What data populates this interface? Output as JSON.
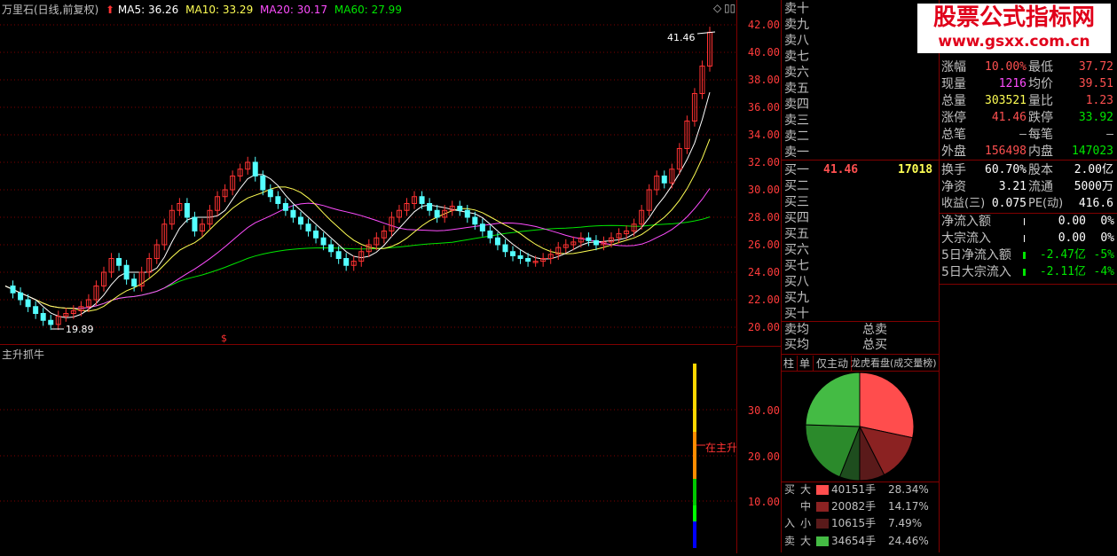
{
  "chart_title": "万里石(日线,前复权)",
  "ma_legend": [
    {
      "label": "MA5: 36.26",
      "color": "#ffffff"
    },
    {
      "label": "MA10: 33.29",
      "color": "#ffff54"
    },
    {
      "label": "MA20: 30.17",
      "color": "#ff4dff"
    },
    {
      "label": "MA60: 27.99",
      "color": "#00e600"
    }
  ],
  "price_ticks": [
    "42.00",
    "40.00",
    "38.00",
    "36.00",
    "34.00",
    "32.00",
    "30.00",
    "28.00",
    "26.00",
    "24.00",
    "22.00",
    "20.00"
  ],
  "high_label": "41.46",
  "low_label": "19.89",
  "dollar_mark": "$",
  "sub_title": "主升抓牛",
  "sub_ticks": [
    "30.00",
    "20.00",
    "10.00"
  ],
  "sub_annotation": "在主升",
  "orderbook": {
    "sell": [
      "卖十",
      "卖九",
      "卖八",
      "卖七",
      "卖六",
      "卖五",
      "卖四",
      "卖三",
      "卖二",
      "卖一"
    ],
    "buy": [
      "买一",
      "买二",
      "买三",
      "买四",
      "买五",
      "买六",
      "买七",
      "买八",
      "买九",
      "买十"
    ],
    "buy1_price": "41.46",
    "buy1_vol": "17018",
    "avg_sell": "卖均",
    "avg_buy": "买均",
    "total_sell": "总卖",
    "total_buy": "总买"
  },
  "watermark": {
    "title": "股票公式指标网",
    "url": "www.gsxx.com.cn"
  },
  "quote": [
    {
      "l": "涨幅",
      "lv": "10.00%",
      "lc": "red",
      "r": "最低",
      "rv": "37.72",
      "rc": "red"
    },
    {
      "l": "现量",
      "lv": "1216",
      "lc": "magenta",
      "r": "均价",
      "rv": "39.51",
      "rc": "red"
    },
    {
      "l": "总量",
      "lv": "303521",
      "lc": "yellow",
      "r": "量比",
      "rv": "1.23",
      "rc": "red"
    },
    {
      "l": "涨停",
      "lv": "41.46",
      "lc": "red",
      "r": "跌停",
      "rv": "33.92",
      "rc": "green"
    },
    {
      "l": "总笔",
      "lv": "–",
      "lc": "grey",
      "r": "每笔",
      "rv": "–",
      "rc": "grey"
    },
    {
      "l": "外盘",
      "lv": "156498",
      "lc": "red",
      "r": "内盘",
      "rv": "147023",
      "rc": "green"
    }
  ],
  "fundamentals": [
    {
      "l": "换手",
      "lv": "60.70%",
      "r": "股本",
      "rv": "2.00亿"
    },
    {
      "l": "净资",
      "lv": "3.21",
      "r": "流通",
      "rv": "5000万"
    },
    {
      "l": "收益(三)",
      "lv": "0.075",
      "r": "PE(动)",
      "rv": "416.6"
    }
  ],
  "flow": [
    {
      "l": "净流入额",
      "v": "0.00",
      "p": "0%",
      "c": "white"
    },
    {
      "l": "大宗流入",
      "v": "0.00",
      "p": "0%",
      "c": "white"
    },
    {
      "l": "5日净流入额",
      "v": "-2.47亿",
      "p": "-5%",
      "c": "green"
    },
    {
      "l": "5日大宗流入",
      "v": "-2.11亿",
      "p": "-4%",
      "c": "green"
    }
  ],
  "tabs": [
    "柱",
    "单",
    "仅主动",
    "龙虎看盘(成交量榜)"
  ],
  "legend": [
    {
      "side": "买",
      "size": "大",
      "vol": "40151手",
      "pct": "28.34%",
      "color": "#ff4d4d"
    },
    {
      "side": "",
      "size": "中",
      "vol": "20082手",
      "pct": "14.17%",
      "color": "#8b2222"
    },
    {
      "side": "入",
      "size": "小",
      "vol": "10615手",
      "pct": "7.49%",
      "color": "#5a1a1a"
    },
    {
      "side": "卖",
      "size": "大",
      "vol": "34654手",
      "pct": "24.46%",
      "color": "#44bb44"
    }
  ],
  "colors": {
    "up": "#ff3232",
    "down": "#54ffff",
    "ma5": "#ffffff",
    "ma10": "#ffff54",
    "ma20": "#ff4dff",
    "ma60": "#00e600",
    "grid": "#800000"
  }
}
